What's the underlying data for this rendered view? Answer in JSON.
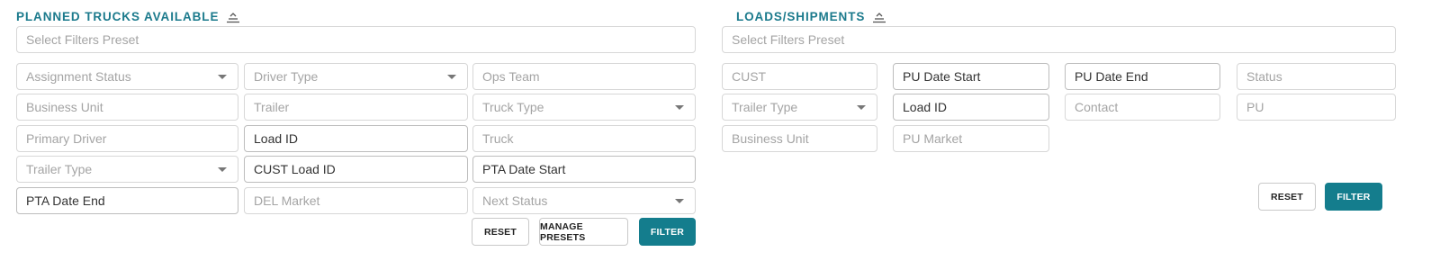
{
  "colors": {
    "accent": "#1b7a8c",
    "primary_button": "#147d8d"
  },
  "trucks_panel": {
    "title": "PLANNED TRUCKS AVAILABLE",
    "preset_placeholder": "Select Filters Preset",
    "filters": {
      "assignment_status": "Assignment Status",
      "driver_type": "Driver Type",
      "ops_team": "Ops Team",
      "business_unit": "Business Unit",
      "trailer": "Trailer",
      "truck_type": "Truck Type",
      "primary_driver": "Primary Driver",
      "load_id": "Load ID",
      "truck": "Truck",
      "trailer_type": "Trailer Type",
      "cust_load_id": "CUST Load ID",
      "pta_date_start": "PTA Date Start",
      "pta_date_end": "PTA Date End",
      "del_market": "DEL Market",
      "next_status": "Next Status"
    },
    "buttons": {
      "reset": "RESET",
      "manage_presets": "MANAGE PRESETS",
      "filter": "FILTER"
    }
  },
  "loads_panel": {
    "title": "LOADS/SHIPMENTS",
    "preset_placeholder": "Select Filters Preset",
    "filters": {
      "cust": "CUST",
      "pu_date_start": "PU Date Start",
      "pu_date_end": "PU Date End",
      "status": "Status",
      "trailer_type": "Trailer Type",
      "load_id": "Load ID",
      "contact": "Contact",
      "pu": "PU",
      "business_unit": "Business Unit",
      "pu_market": "PU Market"
    },
    "buttons": {
      "reset": "RESET",
      "filter": "FILTER"
    }
  }
}
